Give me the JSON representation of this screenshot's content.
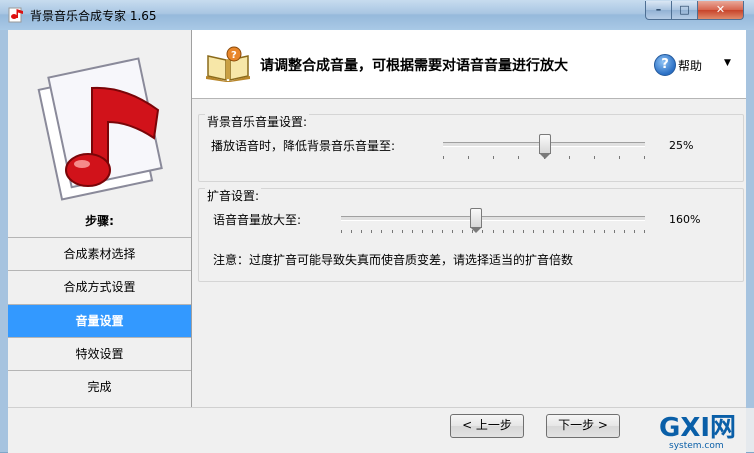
{
  "window": {
    "title": "背景音乐合成专家 1.65",
    "minimize_glyph": "–",
    "maximize_glyph": "□",
    "close_glyph": "✕"
  },
  "sidebar": {
    "steps_title": "步骤:",
    "items": [
      {
        "label": "合成素材选择",
        "active": false
      },
      {
        "label": "合成方式设置",
        "active": false
      },
      {
        "label": "音量设置",
        "active": true
      },
      {
        "label": "特效设置",
        "active": false
      },
      {
        "label": "完成",
        "active": false
      }
    ],
    "active_color": "#3399ff"
  },
  "header": {
    "text": "请调整合成音量，可根据需要对语音音量进行放大",
    "help_label": "帮助",
    "help_glyph": "?",
    "help_arrow": "▼"
  },
  "bg_music_group": {
    "title": "背景音乐音量设置:",
    "label": "播放语音时，降低背景音乐音量至:",
    "value_text": "25%",
    "slider_fraction": 0.5
  },
  "amplify_group": {
    "title": "扩音设置:",
    "label": "语音音量放大至:",
    "value_text": "160%",
    "slider_fraction": 0.44,
    "note": "注意：过度扩音可能导致失真而使音质变差，请选择适当的扩音倍数"
  },
  "footer": {
    "prev_label": "< 上一步",
    "next_label": "下一步 >"
  },
  "watermark": {
    "brand": "GXI网",
    "domain": "system.com"
  },
  "icons": [
    "app-music-icon",
    "music-note-logo",
    "book-icon",
    "help-icon"
  ]
}
